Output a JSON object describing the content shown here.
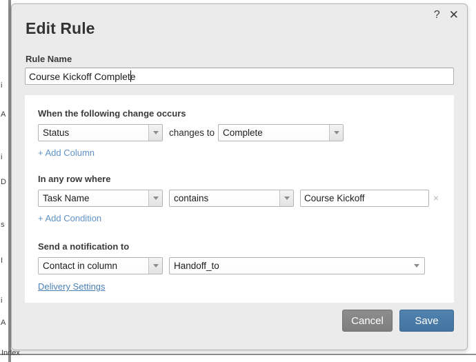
{
  "background": {
    "edge_fragments": [
      "i",
      "A",
      "i",
      "D",
      "s",
      "I",
      "i",
      "A"
    ],
    "bottom_text": "Index"
  },
  "modal": {
    "title": "Edit Rule",
    "help_icon": "question-mark-icon",
    "close_icon": "close-icon",
    "rule_name": {
      "label": "Rule Name",
      "value": "Course Kickoff Complete",
      "placeholder": "Rule Name"
    },
    "trigger_section": {
      "label": "When the following change occurs",
      "column_select": "Status",
      "middle_text": "changes to",
      "value_select": "Complete",
      "add_link": "+ Add Column"
    },
    "condition_section": {
      "label": "In any row where",
      "field_select": "Task Name",
      "operator_select": "contains",
      "value_input": "Course Kickoff",
      "value_placeholder": "",
      "remove_icon": "×",
      "add_link": "+ Add Condition"
    },
    "notification_section": {
      "label": "Send a notification to",
      "recipient_type_select": "Contact in column",
      "column_select": "Handoff_to",
      "settings_link": "Delivery Settings"
    },
    "footer": {
      "cancel_label": "Cancel",
      "save_label": "Save"
    },
    "colors": {
      "modal_bg": "#ebebeb",
      "panel_bg": "#ffffff",
      "link_blue": "#5e92c6",
      "link_underlined_blue": "#4a7fb5",
      "save_blue": "#4a7ba7",
      "cancel_gray": "#858585",
      "text_dark": "#333333"
    }
  }
}
